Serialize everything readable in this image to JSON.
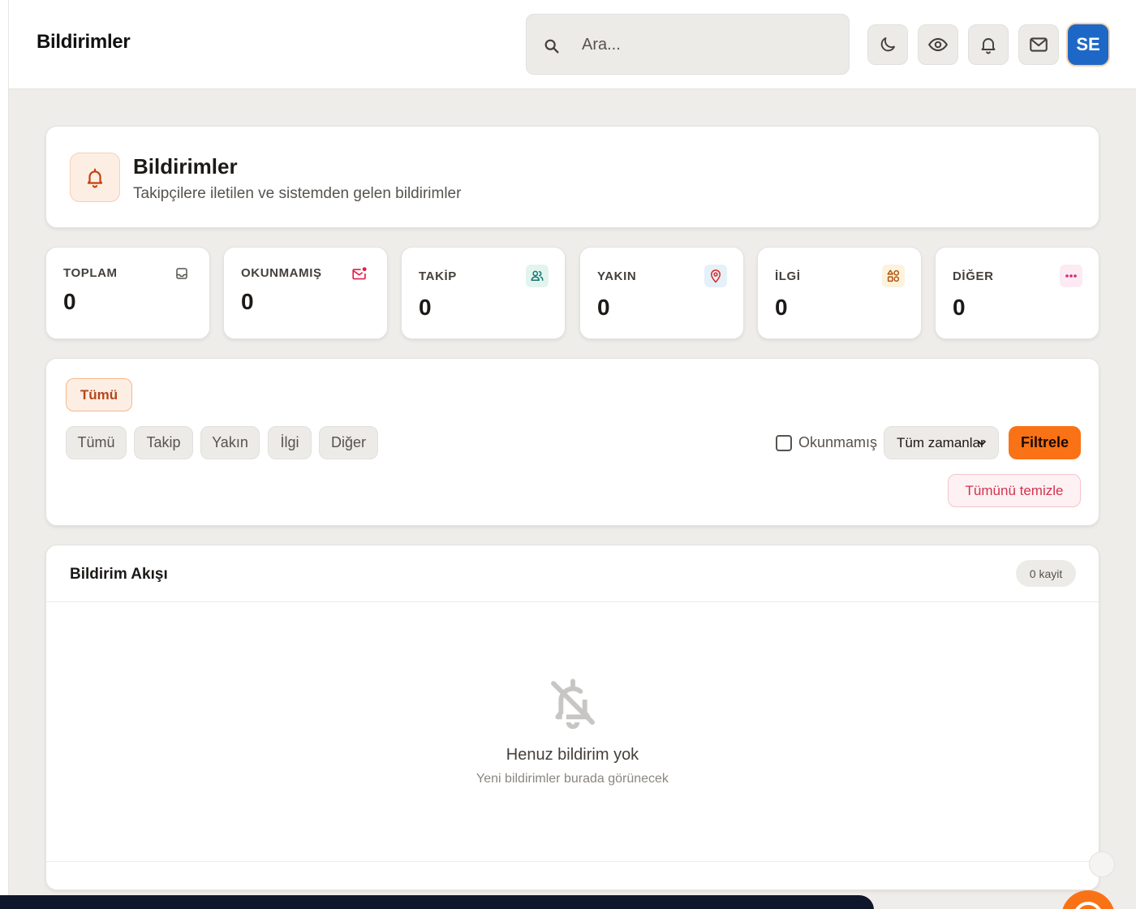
{
  "topbar": {
    "title": "Bildirimler",
    "search_placeholder": "Ara...",
    "avatar_initials": "SE"
  },
  "page_header": {
    "title": "Bildirimler",
    "subtitle": "Takipçilere iletilen ve sistemden gelen bildirimler"
  },
  "stats": [
    {
      "label": "TOPLAM",
      "value": "0",
      "icon": "inbox-icon",
      "color": "#57534e"
    },
    {
      "label": "OKUNMAMIŞ",
      "value": "0",
      "icon": "mail-unread-icon",
      "color": "#e11d48"
    },
    {
      "label": "TAKİP",
      "value": "0",
      "icon": "users-icon",
      "color": "#0f766e"
    },
    {
      "label": "YAKIN",
      "value": "0",
      "icon": "map-pin-icon",
      "color": "#dc2626"
    },
    {
      "label": "İLGİ",
      "value": "0",
      "icon": "interests-icon",
      "color": "#b45309"
    },
    {
      "label": "DİĞER",
      "value": "0",
      "icon": "more-icon",
      "color": "#db2777"
    }
  ],
  "filters": {
    "active_chip": "Tümü",
    "chips": [
      "Tümü",
      "Takip",
      "Yakın",
      "İlgi",
      "Diğer"
    ],
    "unread_label": "Okunmamış",
    "time_select": "Tüm zamanlar",
    "filter_button": "Filtrele",
    "clear_button": "Tümünü temizle"
  },
  "feed": {
    "title": "Bildirim Akışı",
    "count_badge": "0 kayit",
    "empty_title": "Henuz bildirim yok",
    "empty_subtitle": "Yeni bildirimler burada görünecek"
  },
  "colors": {
    "accent": "#f97316",
    "accent_soft": "#fdeee4",
    "danger": "#d1344e",
    "avatar": "#1d68c7"
  }
}
